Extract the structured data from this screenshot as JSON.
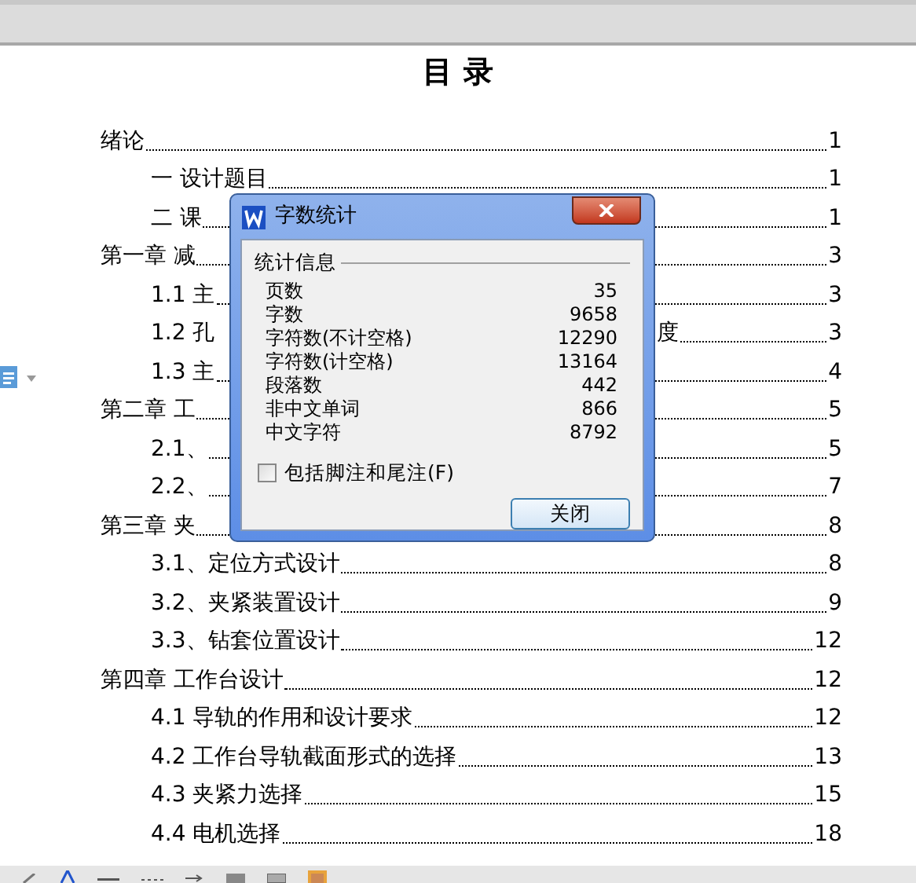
{
  "document": {
    "title": "目 录",
    "toc": [
      {
        "text": "绪论",
        "page": "1",
        "children": [
          {
            "text": "一  设计题目",
            "page": "1"
          },
          {
            "text": "二  课",
            "page": "1"
          }
        ]
      },
      {
        "text": "第一章  减",
        "page": "3",
        "children": [
          {
            "text": "1.1 主",
            "page": "3"
          },
          {
            "text": "1.2 孔",
            "tail": "度",
            "page": "3"
          },
          {
            "text": "1.3 主",
            "page": "4"
          }
        ]
      },
      {
        "text": "第二章  工",
        "page": "5",
        "children": [
          {
            "text": "2.1、",
            "page": "5"
          },
          {
            "text": "2.2、",
            "page": "7"
          }
        ]
      },
      {
        "text": "第三章  夹",
        "page": "8",
        "children": [
          {
            "text": "3.1、定位方式设计",
            "page": "8"
          },
          {
            "text": "3.2、夹紧装置设计",
            "page": "9"
          },
          {
            "text": "3.3、钻套位置设计",
            "page": "12"
          }
        ]
      },
      {
        "text": "第四章  工作台设计",
        "page": "12",
        "children": [
          {
            "text": "4.1 导轨的作用和设计要求",
            "page": "12"
          },
          {
            "text": "4.2 工作台导轨截面形式的选择",
            "page": "13"
          },
          {
            "text": "4.3 夹紧力选择",
            "page": "15"
          },
          {
            "text": "4.4 电机选择",
            "page": "18"
          }
        ]
      }
    ]
  },
  "dialog": {
    "title": "字数统计",
    "group": "统计信息",
    "stats": [
      {
        "label": "页数",
        "value": "35"
      },
      {
        "label": "字数",
        "value": "9658"
      },
      {
        "label": "字符数(不计空格)",
        "value": "12290"
      },
      {
        "label": "字符数(计空格)",
        "value": "13164"
      },
      {
        "label": "段落数",
        "value": "442"
      },
      {
        "label": "非中文单词",
        "value": "866"
      },
      {
        "label": "中文字符",
        "value": "8792"
      }
    ],
    "checkbox": {
      "label": "包括脚注和尾注(F)",
      "checked": false
    },
    "button": "关闭"
  }
}
